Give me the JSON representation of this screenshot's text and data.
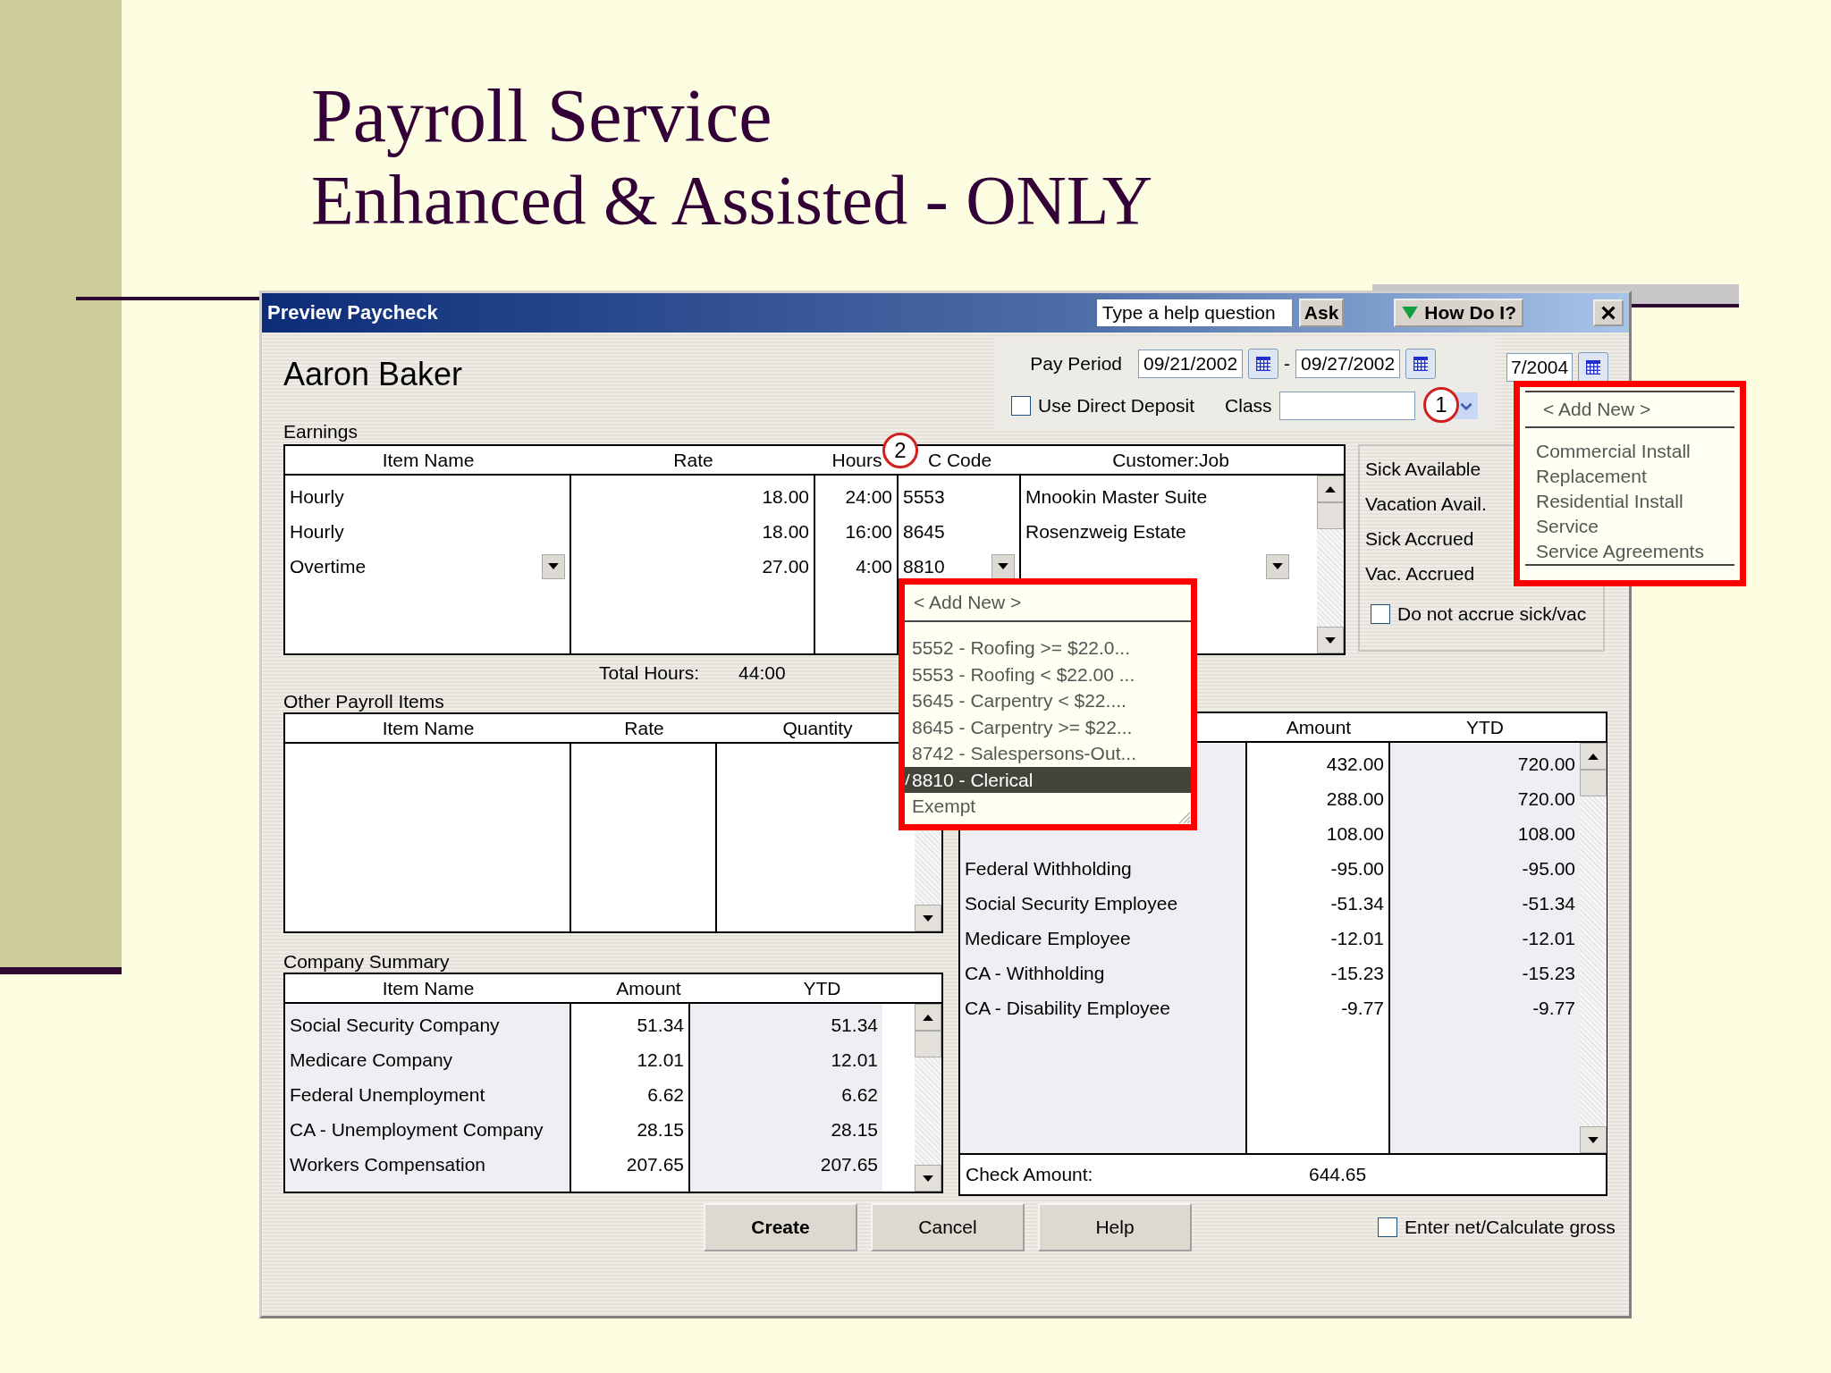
{
  "slide": {
    "title": "Payroll Service",
    "subtitle": "Enhanced & Assisted - ONLY"
  },
  "window": {
    "title": "Preview Paycheck",
    "help_placeholder": "Type a help question",
    "ask_button": "Ask",
    "how_do_i_button": "How Do I?"
  },
  "employee_name": "Aaron Baker",
  "pay_period": {
    "label": "Pay Period",
    "start": "09/21/2002",
    "separator": "-",
    "end": "09/27/2002",
    "check_date": "7/2004"
  },
  "direct_deposit": {
    "label": "Use Direct Deposit",
    "checked": false
  },
  "class_field": {
    "label": "Class",
    "callout": "1"
  },
  "class_dropdown": {
    "items": [
      {
        "label": "< Add New >",
        "kind": "add",
        "selected": false
      },
      {
        "label": "Commercial Install",
        "kind": "item",
        "selected": false
      },
      {
        "label": "Replacement",
        "kind": "item",
        "selected": false
      },
      {
        "label": "Residential Install",
        "kind": "item",
        "selected": false
      },
      {
        "label": "Service",
        "kind": "item",
        "selected": false
      },
      {
        "label": "Service Agreements",
        "kind": "item",
        "selected": false
      }
    ]
  },
  "earnings": {
    "label": "Earnings",
    "callout": "2",
    "columns": [
      "Item Name",
      "Rate",
      "Hours",
      "C Code",
      "Customer:Job"
    ],
    "rows": [
      {
        "item_name": "Hourly",
        "rate": "18.00",
        "hours": "24:00",
        "wc_code": "5553",
        "customer_job": "Mnookin Master Suite",
        "editing": false
      },
      {
        "item_name": "Hourly",
        "rate": "18.00",
        "hours": "16:00",
        "wc_code": "8645",
        "customer_job": "Rosenzweig Estate",
        "editing": false
      },
      {
        "item_name": "Overtime",
        "rate": "27.00",
        "hours": "4:00",
        "wc_code": "8810",
        "editing": true
      }
    ],
    "total_hours_label": "Total Hours:",
    "total_hours": "44:00"
  },
  "accruals": {
    "labels": [
      "Sick Available",
      "Vacation Avail.",
      "Sick Accrued",
      "Vac. Accrued"
    ],
    "no_accrue": {
      "label": "Do not accrue sick/vac",
      "checked": false
    }
  },
  "wc_code_dropdown": {
    "items": [
      {
        "label": "< Add New >",
        "kind": "add",
        "selected": false
      },
      {
        "label": "5552 - Roofing >= $22.0...",
        "kind": "item",
        "selected": false
      },
      {
        "label": "5553 - Roofing < $22.00 ...",
        "kind": "item",
        "selected": false
      },
      {
        "label": "5645 - Carpentry < $22....",
        "kind": "item",
        "selected": false
      },
      {
        "label": "8645 - Carpentry >= $22...",
        "kind": "item",
        "selected": false
      },
      {
        "label": "8742 - Salespersons-Out...",
        "kind": "item",
        "selected": false
      },
      {
        "label": "8810 - Clerical",
        "kind": "item",
        "selected": true
      },
      {
        "label": "Exempt",
        "kind": "item",
        "selected": false
      }
    ]
  },
  "other_payroll_items": {
    "label": "Other Payroll Items",
    "columns": [
      "Item Name",
      "Rate",
      "Quantity"
    ]
  },
  "employee_summary": {
    "columns": [
      "Amount",
      "YTD"
    ],
    "rows": [
      {
        "amount": "432.00",
        "ytd": "720.00"
      },
      {
        "amount": "288.00",
        "ytd": "720.00"
      },
      {
        "amount": "108.00",
        "ytd": "108.00"
      },
      {
        "item_name": "Federal Withholding",
        "amount": "-95.00",
        "ytd": "-95.00"
      },
      {
        "item_name": "Social Security Employee",
        "amount": "-51.34",
        "ytd": "-51.34"
      },
      {
        "item_name": "Medicare Employee",
        "amount": "-12.01",
        "ytd": "-12.01"
      },
      {
        "item_name": "CA - Withholding",
        "amount": "-15.23",
        "ytd": "-15.23"
      },
      {
        "item_name": "CA - Disability Employee",
        "amount": "-9.77",
        "ytd": "-9.77"
      }
    ],
    "check_amount_label": "Check Amount:",
    "check_amount": "644.65"
  },
  "company_summary": {
    "label": "Company Summary",
    "columns": [
      "Item Name",
      "Amount",
      "YTD"
    ],
    "rows": [
      {
        "item_name": "Social Security Company",
        "amount": "51.34",
        "ytd": "51.34"
      },
      {
        "item_name": "Medicare Company",
        "amount": "12.01",
        "ytd": "12.01"
      },
      {
        "item_name": "Federal Unemployment",
        "amount": "6.62",
        "ytd": "6.62"
      },
      {
        "item_name": "CA - Unemployment Company",
        "amount": "28.15",
        "ytd": "28.15"
      },
      {
        "item_name": "Workers Compensation",
        "amount": "207.65",
        "ytd": "207.65"
      }
    ]
  },
  "buttons": [
    {
      "label": "Create",
      "kind": "default"
    },
    {
      "label": "Cancel",
      "kind": "normal"
    },
    {
      "label": "Help",
      "kind": "normal"
    }
  ],
  "enter_net": {
    "label": "Enter net/Calculate gross",
    "checked": false
  }
}
